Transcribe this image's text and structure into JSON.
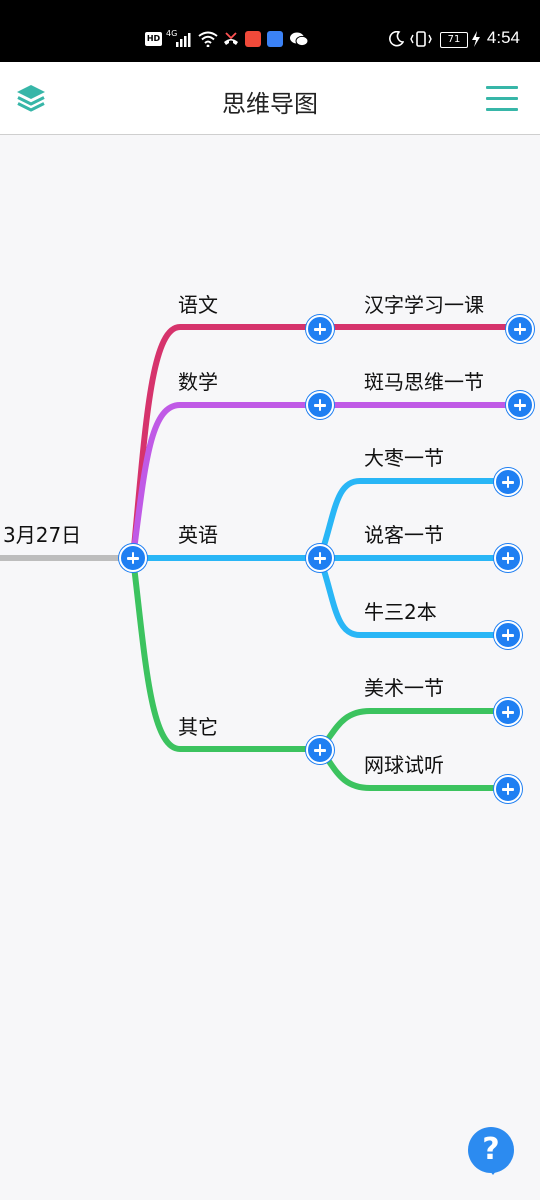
{
  "status_bar": {
    "hd_badge": "HD",
    "network": "4G",
    "battery": "71",
    "time": "4:54",
    "icons": [
      "signal-icon",
      "wifi-icon",
      "missed-call-icon",
      "app-notification-icon",
      "app-notification-icon",
      "wechat-icon",
      "moon-icon",
      "vibrate-icon",
      "battery-icon",
      "charging-icon"
    ]
  },
  "header": {
    "title": "思维导图",
    "left_icon": "layers-icon",
    "right_icon": "menu-icon",
    "accent": "#37b6a8"
  },
  "mindmap": {
    "root": {
      "label": "3月27日",
      "color": "#bdbdbd"
    },
    "branches": [
      {
        "label": "语文",
        "color": "#d6336c",
        "children": [
          {
            "label": "汉字学习一课"
          }
        ]
      },
      {
        "label": "数学",
        "color": "#c05ae6",
        "children": [
          {
            "label": "斑马思维一节"
          }
        ]
      },
      {
        "label": "英语",
        "color": "#29b6f6",
        "children": [
          {
            "label": "大枣一节"
          },
          {
            "label": "说客一节"
          },
          {
            "label": "牛三2本"
          }
        ]
      },
      {
        "label": "其它",
        "color": "#3cc35f",
        "children": [
          {
            "label": "美术一节"
          },
          {
            "label": "网球试听"
          }
        ]
      }
    ],
    "plus_color": "#1f7ff2"
  },
  "help_button": {
    "label": "?",
    "color": "#2c8bf0"
  }
}
